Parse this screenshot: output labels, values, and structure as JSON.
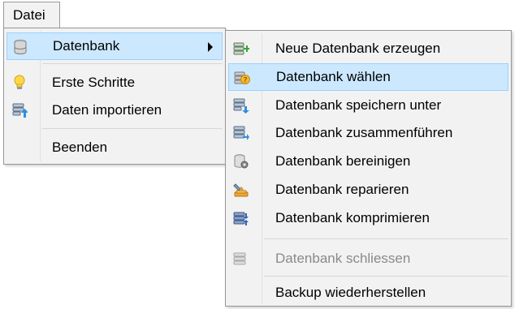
{
  "menubar": {
    "file_label": "Datei"
  },
  "main_menu": {
    "items": [
      {
        "label": "Datenbank",
        "icon": "database-icon"
      },
      {
        "label": "Erste Schritte",
        "icon": "lightbulb-icon"
      },
      {
        "label": "Daten importieren",
        "icon": "database-import-icon"
      },
      {
        "label": "Beenden"
      }
    ]
  },
  "submenu": {
    "items": [
      {
        "label": "Neue Datenbank erzeugen",
        "icon": "database-add-icon"
      },
      {
        "label": "Datenbank wählen",
        "icon": "database-select-icon"
      },
      {
        "label": "Datenbank speichern unter",
        "icon": "database-save-icon"
      },
      {
        "label": "Datenbank zusammenführen",
        "icon": "database-merge-icon"
      },
      {
        "label": "Datenbank bereinigen",
        "icon": "database-clean-icon"
      },
      {
        "label": "Datenbank reparieren",
        "icon": "database-repair-icon"
      },
      {
        "label": "Datenbank komprimieren",
        "icon": "database-compress-icon"
      },
      {
        "label": "Datenbank schliessen",
        "icon": "database-close-icon",
        "disabled": true
      },
      {
        "label": "Backup wiederherstellen"
      }
    ]
  },
  "colors": {
    "menu_bg": "#f2f2f2",
    "highlight_bg": "#cce8ff",
    "highlight_border": "#99d1ff",
    "disabled_text": "#8a8a8a"
  }
}
